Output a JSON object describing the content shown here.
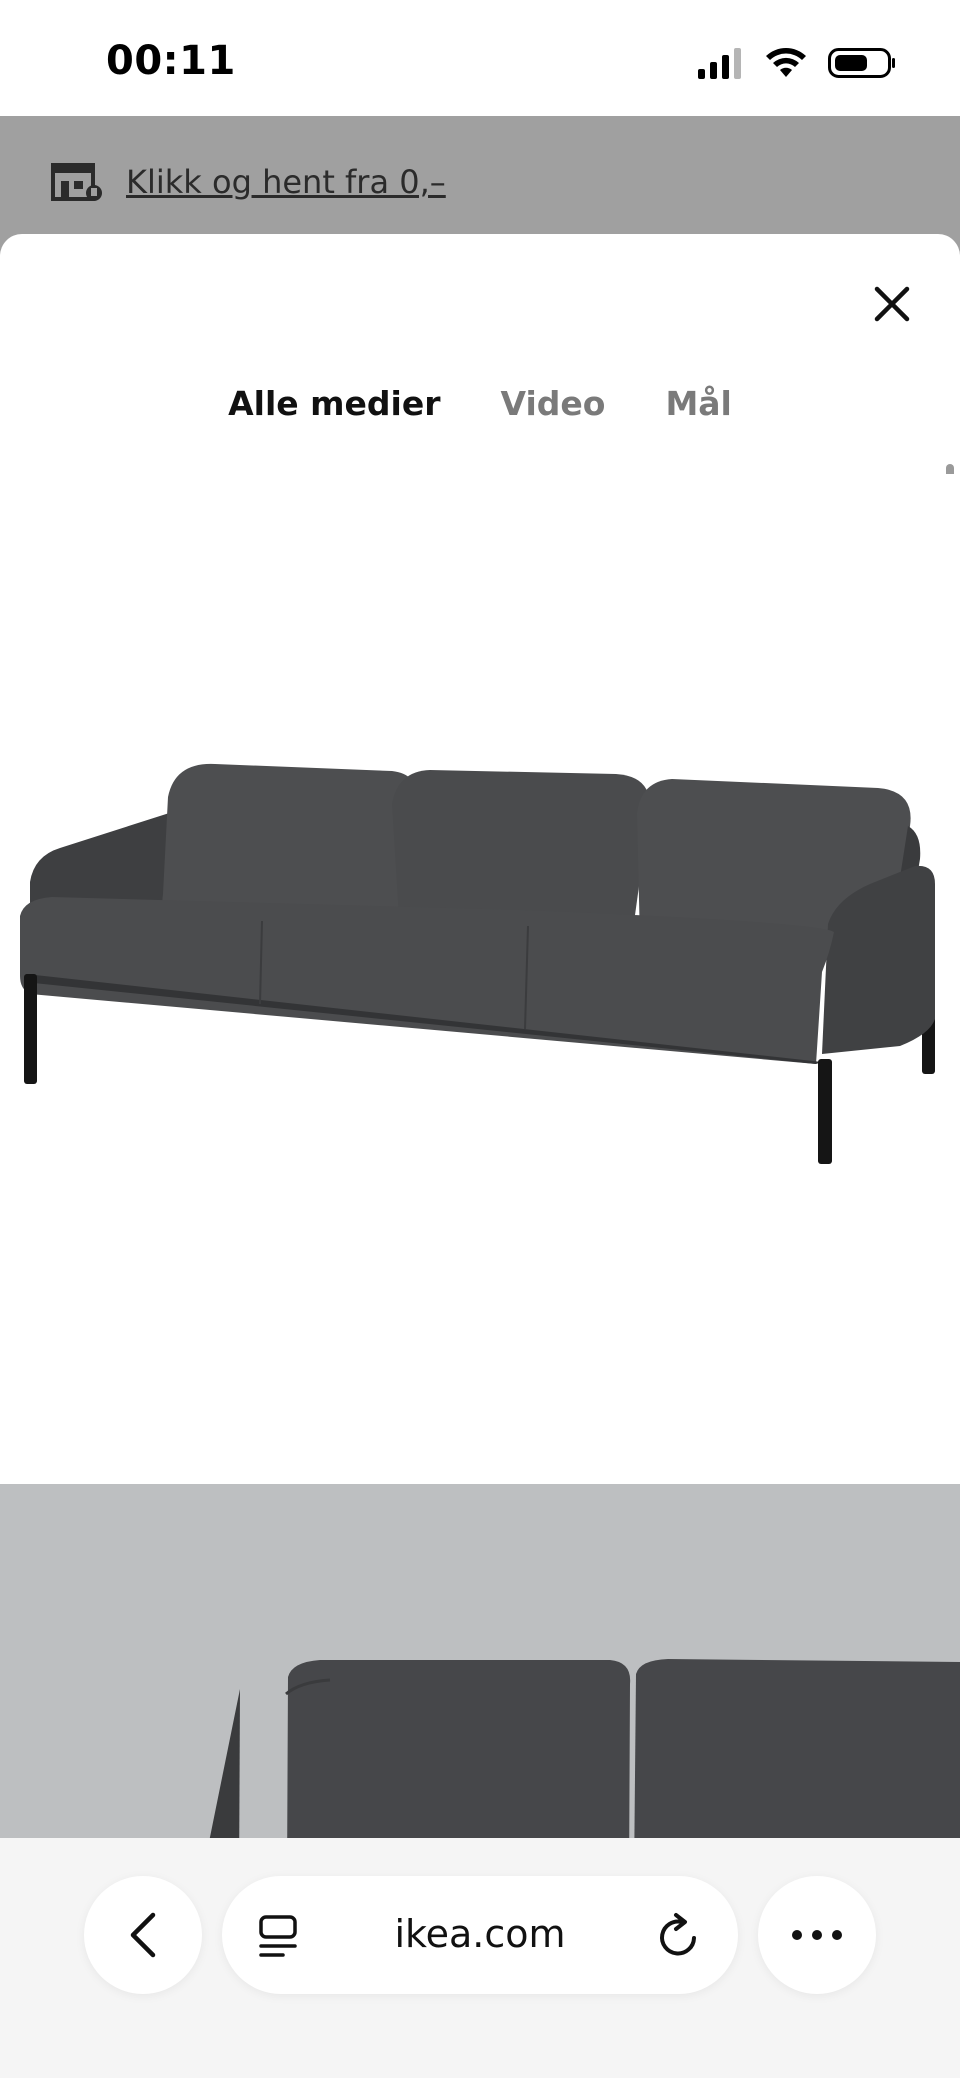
{
  "status_bar": {
    "time": "00:11",
    "icons": [
      "cellular-signal-icon",
      "wifi-icon",
      "battery-icon"
    ]
  },
  "background_page": {
    "promo_text": "Klikk og hent fra 0,–",
    "promo_icon": "store-pickup-icon"
  },
  "media_viewer": {
    "tabs": [
      {
        "label": "Alle medier",
        "active": true
      },
      {
        "label": "Video",
        "active": false
      },
      {
        "label": "Mål",
        "active": false
      }
    ],
    "images": [
      {
        "subject": "sofa-product-image",
        "background": "#ffffff"
      },
      {
        "subject": "sofa-lifestyle-image",
        "background": "#bdbfc1"
      }
    ],
    "product_color": "#4a4b4d"
  },
  "browser": {
    "url": "ikea.com",
    "icons": [
      "back-icon",
      "reader-icon",
      "reload-icon",
      "more-icon"
    ]
  }
}
